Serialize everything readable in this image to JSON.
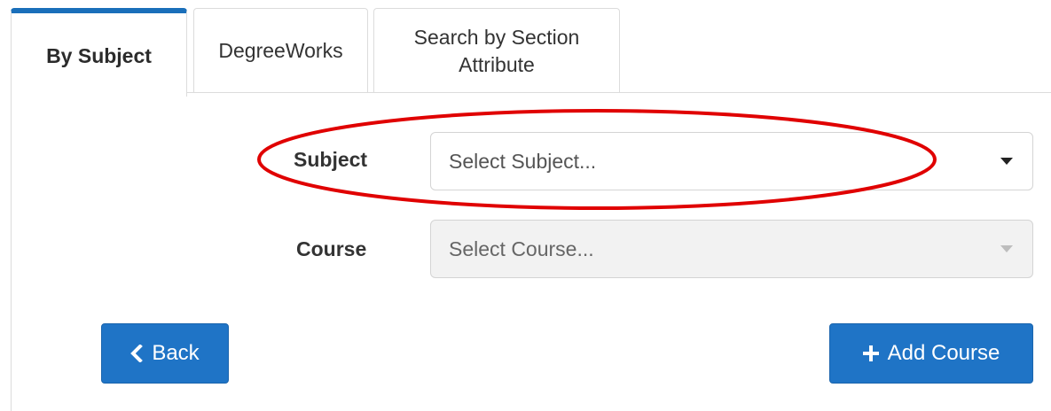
{
  "tabs": [
    {
      "label": "By Subject",
      "active": true
    },
    {
      "label": "DegreeWorks",
      "active": false
    },
    {
      "label": "Search by Section Attribute",
      "active": false
    }
  ],
  "form": {
    "subject_label": "Subject",
    "subject_placeholder": "Select Subject...",
    "course_label": "Course",
    "course_placeholder": "Select Course..."
  },
  "buttons": {
    "back_label": "Back",
    "add_course_label": "Add Course"
  },
  "icons": {
    "back": "chevron-left-icon",
    "add": "plus-icon",
    "dropdown": "caret-down-icon"
  },
  "colors": {
    "accent": "#1f74c6",
    "tab_active_border": "#1a6fba",
    "highlight_ellipse": "#e00000"
  }
}
